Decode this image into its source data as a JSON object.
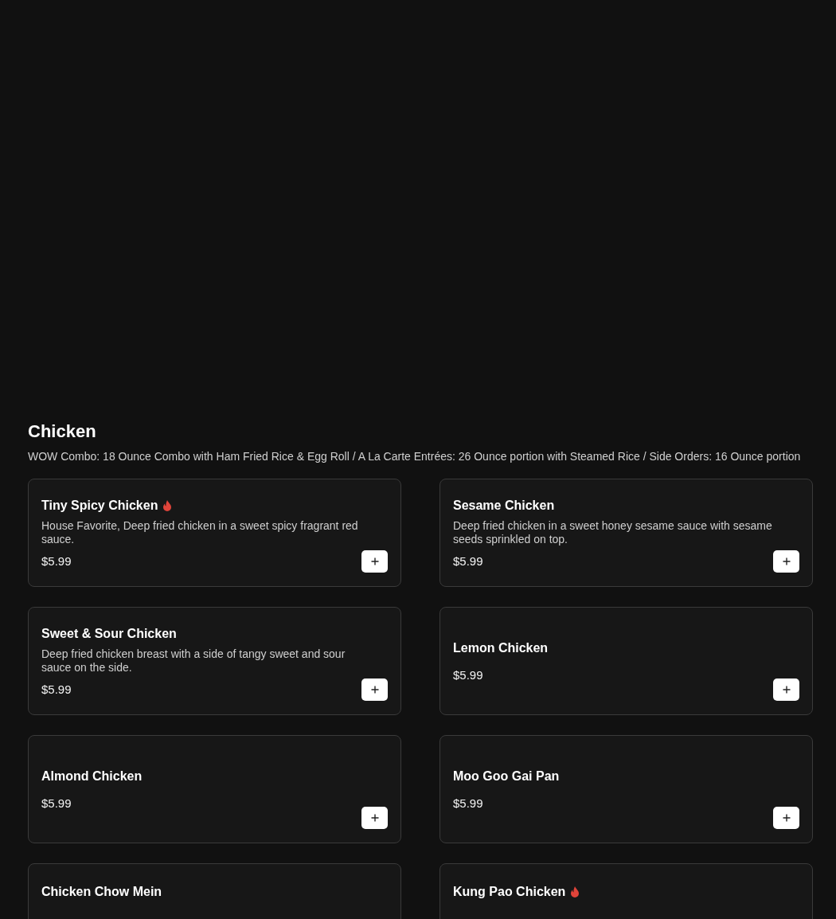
{
  "category": {
    "title": "Chicken",
    "description": "WOW Combo: 18 Ounce Combo with Ham Fried Rice & Egg Roll / A La Carte Entrées: 26 Ounce portion with Steamed Rice / Side Orders: 16 Ounce portion"
  },
  "items": [
    {
      "name": "Tiny Spicy Chicken",
      "spicy": true,
      "description": "House Favorite, Deep fried chicken in a sweet spicy fragrant red sauce.",
      "price": "$5.99"
    },
    {
      "name": "Sesame Chicken",
      "spicy": false,
      "description": "Deep fried chicken in a sweet honey sesame sauce with sesame seeds sprinkled on top.",
      "price": "$5.99"
    },
    {
      "name": "Sweet & Sour Chicken",
      "spicy": false,
      "description": "Deep fried chicken breast with a side of tangy sweet and sour sauce on the side.",
      "price": "$5.99"
    },
    {
      "name": "Lemon Chicken",
      "spicy": false,
      "price": "$5.99"
    },
    {
      "name": "Almond Chicken",
      "spicy": false,
      "price": "$5.99"
    },
    {
      "name": "Moo Goo Gai Pan",
      "spicy": false,
      "price": "$5.99"
    },
    {
      "name": "Chicken Chow Mein",
      "spicy": false
    },
    {
      "name": "Kung Pao Chicken",
      "spicy": true
    }
  ]
}
